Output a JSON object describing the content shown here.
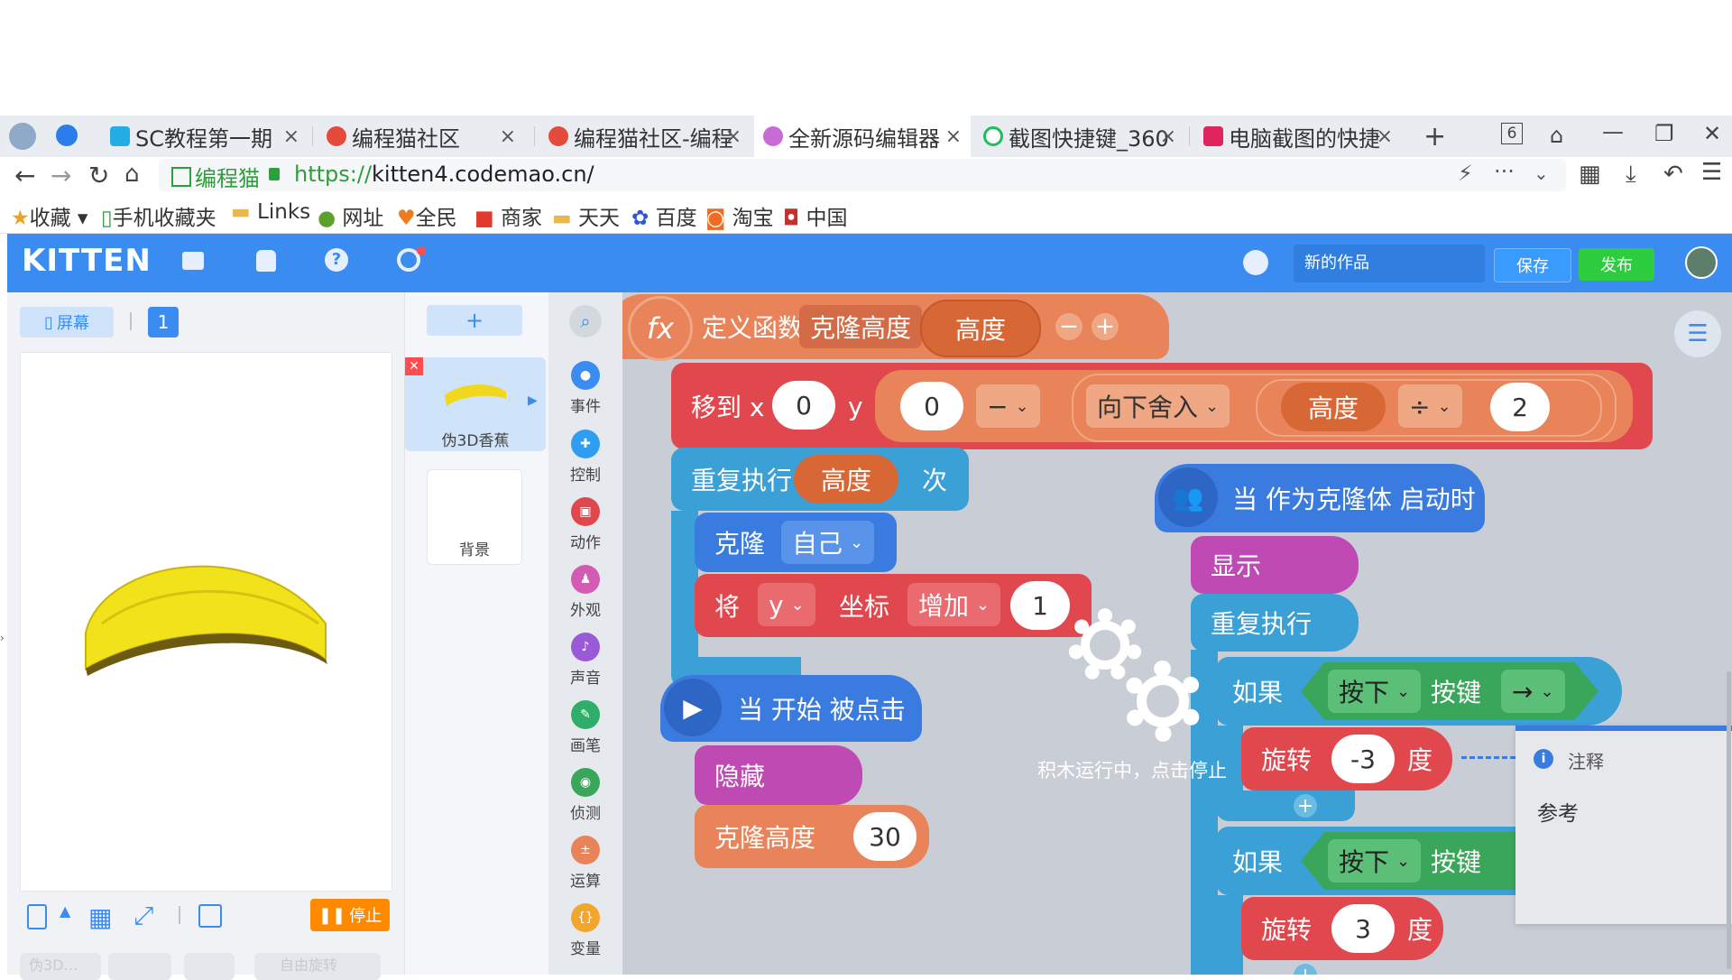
{
  "browser": {
    "tabs": [
      {
        "title": "SC教程第一期"
      },
      {
        "title": "编程猫社区"
      },
      {
        "title": "编程猫社区-编程"
      },
      {
        "title": "全新源码编辑器"
      },
      {
        "title": "截图快捷键_360"
      },
      {
        "title": "电脑截图的快捷"
      }
    ],
    "tab_close": "×",
    "new_tab": "+",
    "tab_count": "6",
    "site_label": "编程猫",
    "url_scheme": "https://",
    "url_rest": "kitten4.codemao.cn/",
    "bookmarks": [
      "收藏",
      "手机收藏夹",
      "Links",
      "网址",
      "全民",
      "商家",
      "天天",
      "百度",
      "淘宝",
      "中国"
    ],
    "colors": {
      "tabbar": "#e9ecf1",
      "https": "#2e9d3b"
    }
  },
  "app": {
    "logo": "KITTEN",
    "work_name": "新的作品",
    "save_label": "保存",
    "publish_label": "发布",
    "colors": {
      "header": "#3a8cf0",
      "save": "#3a9bff",
      "publish": "#2ecc3f"
    }
  },
  "stage": {
    "screen_label": "屏幕",
    "screen_number": "1",
    "stop_label": "停止",
    "bottom_chips": [
      "伪3D…",
      "自由旋转"
    ]
  },
  "sprites": {
    "add_label": "+",
    "items": [
      {
        "name": "伪3D香蕉"
      },
      {
        "name": "背景"
      }
    ]
  },
  "categories": [
    {
      "label": "事件",
      "color": "#3a8cf0"
    },
    {
      "label": "控制",
      "color": "#2f9df0"
    },
    {
      "label": "动作",
      "color": "#e0484e"
    },
    {
      "label": "外观",
      "color": "#d45bb3"
    },
    {
      "label": "声音",
      "color": "#9a5ad8"
    },
    {
      "label": "画笔",
      "color": "#2fae6a"
    },
    {
      "label": "侦测",
      "color": "#3aa65a"
    },
    {
      "label": "运算",
      "color": "#e8835a"
    },
    {
      "label": "变量",
      "color": "#f2a62e"
    }
  ],
  "blocks": {
    "define_func": "定义函数",
    "func_name": "克隆高度",
    "param": "高度",
    "move_to_x": "移到 x",
    "y_label": "y",
    "x_val": "0",
    "y_val": "0",
    "minus": "−",
    "round_down": "向下舍入",
    "divide": "÷",
    "div_val": "2",
    "repeat": "重复执行",
    "times": "次",
    "clone": "克隆",
    "self": "自己",
    "set": "将",
    "coord": "坐标",
    "increase": "增加",
    "inc_val": "1",
    "when_start": "当 开始 被点击",
    "hide": "隐藏",
    "clone_height": "克隆高度",
    "clone_height_val": "30",
    "when_clone": "当 作为克隆体 启动时",
    "show": "显示",
    "if": "如果",
    "press": "按下",
    "key": "按键",
    "right_arrow": "→",
    "rotate": "旋转",
    "rot1": "-3",
    "degree": "度",
    "rot2": "3",
    "plus": "+"
  },
  "overlay": {
    "running": "积木运行中，点击停止"
  },
  "comment": {
    "title": "注释",
    "body": "参考"
  }
}
